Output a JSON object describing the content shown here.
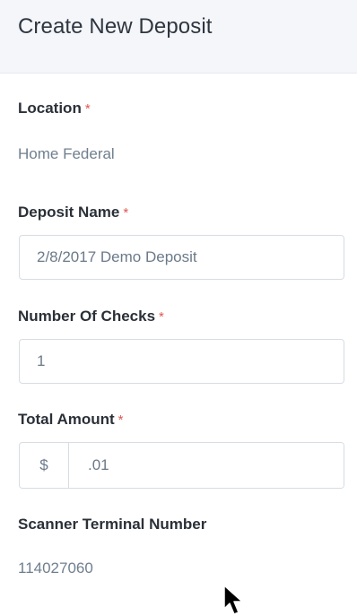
{
  "header": {
    "title": "Create New Deposit"
  },
  "form": {
    "location": {
      "label": "Location",
      "required_mark": "*",
      "value": "Home Federal"
    },
    "deposit_name": {
      "label": "Deposit Name",
      "required_mark": "*",
      "value": "2/8/2017 Demo Deposit"
    },
    "number_of_checks": {
      "label": "Number Of Checks",
      "required_mark": "*",
      "value": "1"
    },
    "total_amount": {
      "label": "Total Amount",
      "required_mark": "*",
      "currency_symbol": "$",
      "value": ".01"
    },
    "scanner_terminal": {
      "label": "Scanner Terminal Number",
      "value": "114027060"
    }
  },
  "colors": {
    "required": "#e0574f",
    "header_bg": "#f4f6f9"
  },
  "icons": {
    "cursor": "mouse-pointer-icon"
  }
}
